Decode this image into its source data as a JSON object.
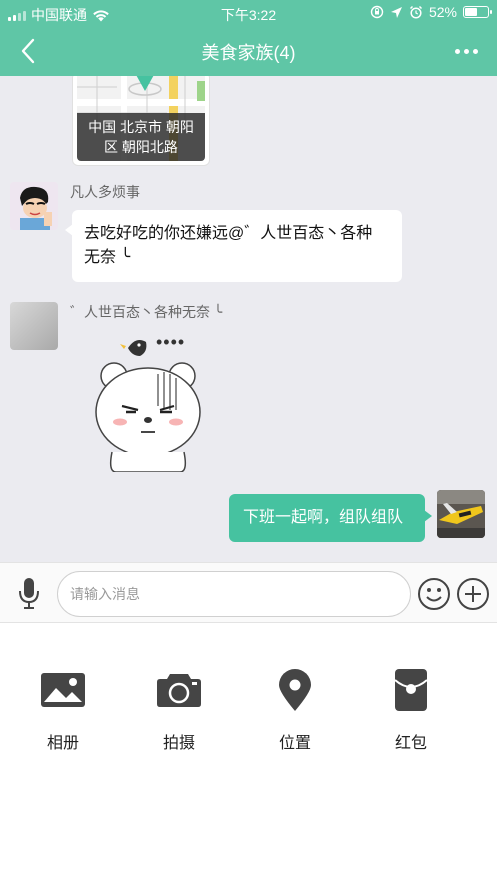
{
  "status_bar": {
    "carrier": "中国联通",
    "time": "下午3:22",
    "battery": "52%"
  },
  "nav": {
    "title": "美食家族(4)"
  },
  "messages": {
    "location": {
      "address_line1": "中国 北京市 朝阳",
      "address_line2": "区 朝阳北路"
    },
    "msg1": {
      "sender": "凡人多烦事",
      "line1": "去吃好吃的你还嫌远@゛人世百态丶各种",
      "line2": "无奈 ╰"
    },
    "msg2": {
      "sender": "゛人世百态丶各种无奈 ╰",
      "sticker_text": "••••"
    },
    "msg3": {
      "text": "下班一起啊，组队组队"
    }
  },
  "input": {
    "placeholder": "请输入消息"
  },
  "tools": [
    {
      "label": "相册",
      "icon": "photo-album-icon"
    },
    {
      "label": "拍摄",
      "icon": "camera-icon"
    },
    {
      "label": "位置",
      "icon": "location-pin-icon"
    },
    {
      "label": "红包",
      "icon": "red-envelope-icon"
    }
  ],
  "colors": {
    "brand": "#5fc6a6",
    "outgoing_bubble": "#46c2a0",
    "chat_bg": "#ebebf0"
  }
}
